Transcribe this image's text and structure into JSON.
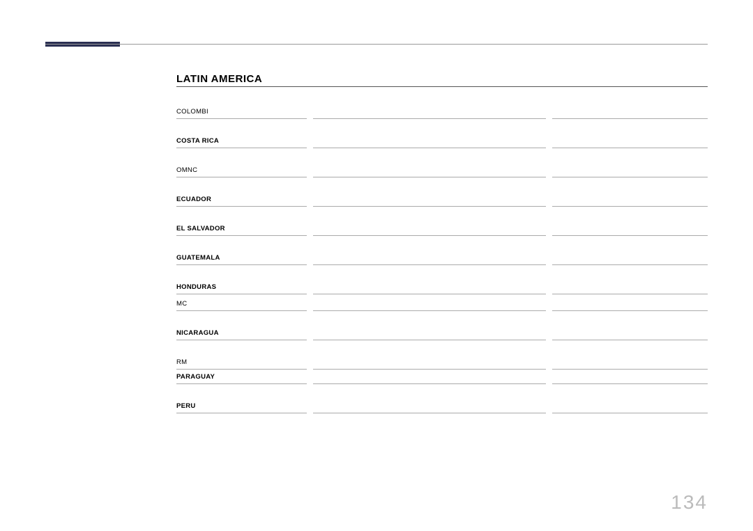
{
  "section_title": "LATIN AMERICA",
  "rows": [
    {
      "label": "COLOMBI",
      "bold": false,
      "height": "h-tall"
    },
    {
      "label": "COSTA RICA",
      "bold": true,
      "height": "h-med"
    },
    {
      "label": "OMNC",
      "bold": false,
      "height": "h-med"
    },
    {
      "label": "ECUADOR",
      "bold": true,
      "height": "h-med"
    },
    {
      "label": "EL SALVADOR",
      "bold": true,
      "height": "h-med"
    },
    {
      "label": "GUATEMALA",
      "bold": true,
      "height": "h-med"
    },
    {
      "label": "HONDURAS",
      "bold": true,
      "height": "h-med"
    },
    {
      "label": "MC",
      "bold": false,
      "height": "h-short"
    },
    {
      "label": "NICARAGUA",
      "bold": true,
      "height": "h-med"
    },
    {
      "label": "RM",
      "bold": false,
      "height": "h-med"
    },
    {
      "label": "PARAGUAY",
      "bold": true,
      "height": "h-vshort"
    },
    {
      "label": "PERU",
      "bold": true,
      "height": "h-med"
    }
  ],
  "page_number": "134"
}
